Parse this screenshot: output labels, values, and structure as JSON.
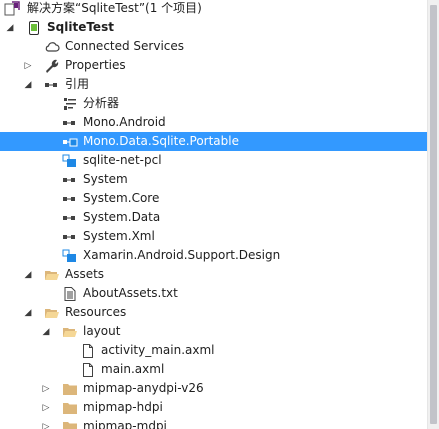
{
  "solution": {
    "label": "解决方案“SqliteTest”(1 个项目)"
  },
  "project": {
    "label": "SqliteTest"
  },
  "connected_services": {
    "label": "Connected Services"
  },
  "properties": {
    "label": "Properties"
  },
  "references": {
    "label": "引用",
    "items": [
      {
        "label": "分析器"
      },
      {
        "label": "Mono.Android"
      },
      {
        "label": "Mono.Data.Sqlite.Portable",
        "selected": true
      },
      {
        "label": "sqlite-net-pcl"
      },
      {
        "label": "System"
      },
      {
        "label": "System.Core"
      },
      {
        "label": "System.Data"
      },
      {
        "label": "System.Xml"
      },
      {
        "label": "Xamarin.Android.Support.Design"
      }
    ]
  },
  "assets": {
    "label": "Assets",
    "file": "AboutAssets.txt"
  },
  "resources": {
    "label": "Resources",
    "layout": {
      "label": "layout",
      "files": [
        "activity_main.axml",
        "main.axml"
      ]
    },
    "folders": [
      "mipmap-anydpi-v26",
      "mipmap-hdpi",
      "mipmap-mdpi"
    ]
  },
  "colors": {
    "selection": "#3399ff",
    "folder": "#dcb67a"
  }
}
